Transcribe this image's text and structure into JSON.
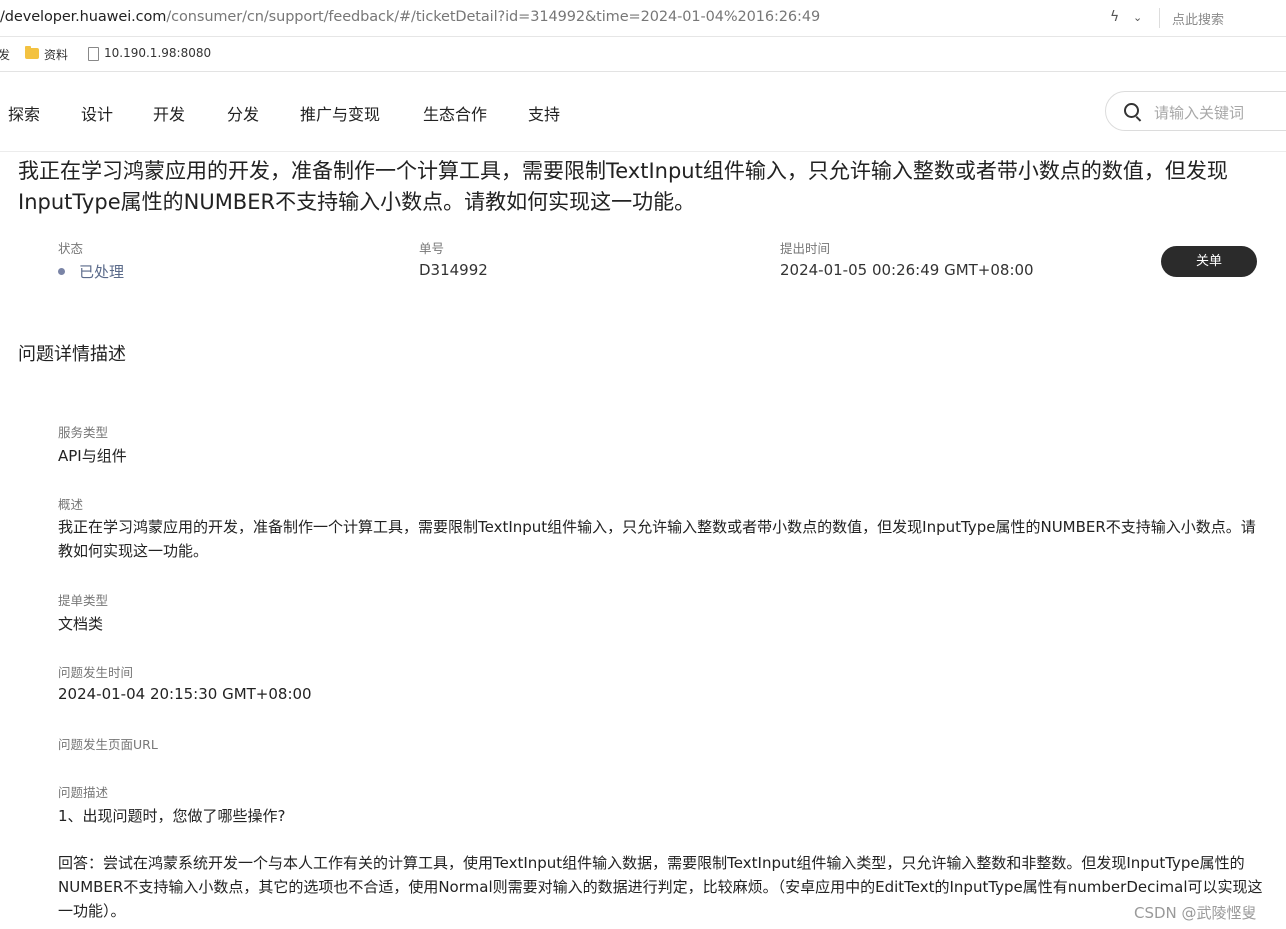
{
  "browser": {
    "url_host": "/developer.huawei.com",
    "url_path": "/consumer/cn/support/feedback/#/ticketDetail?id=314992&time=2024-01-04%2016:26:49",
    "search_placeholder": "点此搜索",
    "bookmarks": [
      "发",
      "资料",
      "10.190.1.98:8080"
    ]
  },
  "nav": {
    "items": [
      "探索",
      "设计",
      "开发",
      "分发",
      "推广与变现",
      "生态合作",
      "支持"
    ],
    "search_placeholder": "请输入关键词"
  },
  "ticket": {
    "title": "我正在学习鸿蒙应用的开发，准备制作一个计算工具，需要限制TextInput组件输入，只允许输入整数或者带小数点的数值，但发现InputType属性的NUMBER不支持输入小数点。请教如何实现这一功能。",
    "status_label": "状态",
    "status_value": "已处理",
    "number_label": "单号",
    "number_value": "D314992",
    "submit_time_label": "提出时间",
    "submit_time_value": "2024-01-05 00:26:49 GMT+08:00",
    "close_button": "关单"
  },
  "details": {
    "section_title": "问题详情描述",
    "service_type_label": "服务类型",
    "service_type_value": "API与组件",
    "summary_label": "概述",
    "summary_value": "我正在学习鸿蒙应用的开发，准备制作一个计算工具，需要限制TextInput组件输入，只允许输入整数或者带小数点的数值，但发现InputType属性的NUMBER不支持输入小数点。请教如何实现这一功能。",
    "ticket_type_label": "提单类型",
    "ticket_type_value": "文档类",
    "occur_time_label": "问题发生时间",
    "occur_time_value": "2024-01-04 20:15:30 GMT+08:00",
    "page_url_label": "问题发生页面URL",
    "description_label": "问题描述",
    "description_q": "1、出现问题时，您做了哪些操作?",
    "description_a": "回答：尝试在鸿蒙系统开发一个与本人工作有关的计算工具，使用TextInput组件输入数据，需要限制TextInput组件输入类型，只允许输入整数和非整数。但发现InputType属性的NUMBER不支持输入小数点，其它的选项也不合适，使用Normal则需要对输入的数据进行判定，比较麻烦。（安卓应用中的EditText的InputType属性有numberDecimal可以实现这一功能）。"
  },
  "watermark": "CSDN @武陵悭叟",
  "colors": {
    "status_dot": "#7a84a6",
    "button_bg": "#2b2b2b"
  }
}
